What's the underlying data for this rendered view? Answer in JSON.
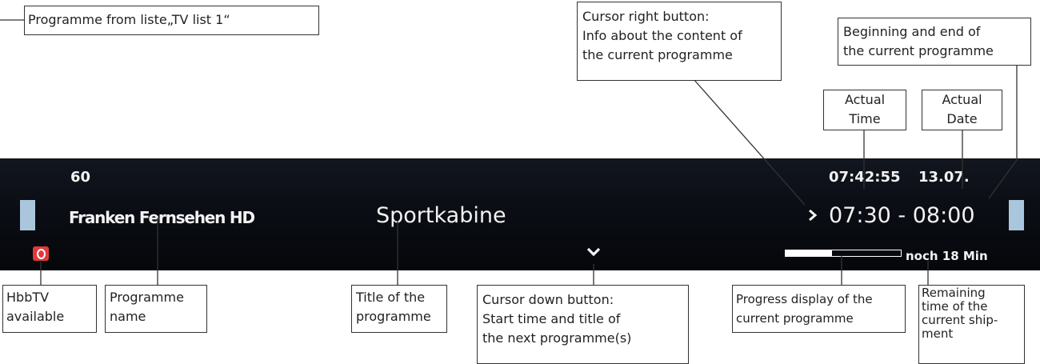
{
  "tv_bar": {
    "channel_number": "60",
    "channel_name": "Franken Fernsehen HD",
    "programme_title": "Sportkabine",
    "clock": "07:42:55",
    "date": "13.07.",
    "programme_time": "07:30 - 08:00",
    "remaining": "noch 18 Min",
    "progress_fraction": 0.4,
    "colors": {
      "bar": "#0b0e15",
      "text": "#f2f2f2",
      "side_tab": "#a9c6dc",
      "hbbtv_icon": "#e13a3a"
    },
    "icons": [
      "hbbtv-icon",
      "chevron-right-icon",
      "chevron-down-icon"
    ]
  },
  "callouts": {
    "list_source": "Programme from liste„TV list 1“",
    "cursor_right": [
      "Cursor right button:",
      "Info about the content of",
      "the current programme"
    ],
    "begin_end": [
      "Beginning and end of",
      "the current programme"
    ],
    "actual_time": [
      "Actual",
      "Time"
    ],
    "actual_date": [
      "Actual",
      "Date"
    ],
    "hbbtv": [
      "HbbTV",
      "available"
    ],
    "programme_name": [
      "Programme",
      "name"
    ],
    "title": [
      "Title of the",
      "programme"
    ],
    "cursor_down": [
      "Cursor down button:",
      "Start time and title of",
      "the next programme(s)"
    ],
    "progress": [
      "Progress display of the",
      "current programme"
    ],
    "remaining_time": [
      "Remaining",
      "time of the",
      "current ship-",
      "ment"
    ]
  }
}
